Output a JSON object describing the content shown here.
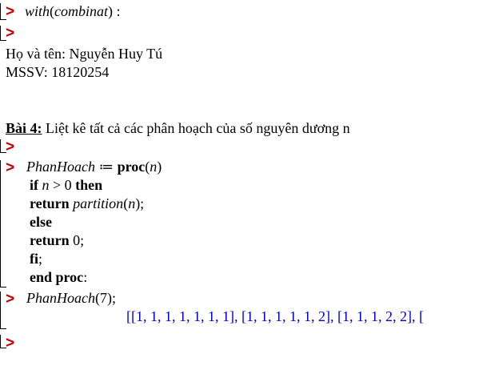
{
  "worksheet": {
    "line1": {
      "cmd": "with",
      "arg": "combinat",
      "suffix": " :"
    },
    "name_line": "Họ và tên: Nguyễn Huy Tú",
    "mssv_line": "MSSV: 18120254",
    "exercise": {
      "label": "Bài 4:",
      "text": " Liệt kê tất cả các phân hoạch của số nguyên dương n"
    },
    "proc": {
      "name": "PhanHoach",
      "assign": " ≔ ",
      "proc_kw": "proc",
      "param": "n",
      "if_kw": "if",
      "cond_var": "n",
      "cond_op": " > ",
      "cond_val": "0",
      "then_kw": "then",
      "return_kw": "return",
      "call": "partition",
      "call_arg": "n",
      "else_kw": "else",
      "ret_zero": "0",
      "fi_kw": "fi",
      "end_kw": "end proc"
    },
    "call_line": {
      "name": "PhanHoach",
      "arg": "7",
      "suffix": ";"
    },
    "output": "[[1, 1, 1, 1, 1, 1, 1], [1, 1, 1, 1, 1, 2], [1, 1, 1, 2, 2], ["
  },
  "prompt_symbol": ">",
  "colors": {
    "prompt": "#c00000",
    "output": "#0000cc"
  }
}
